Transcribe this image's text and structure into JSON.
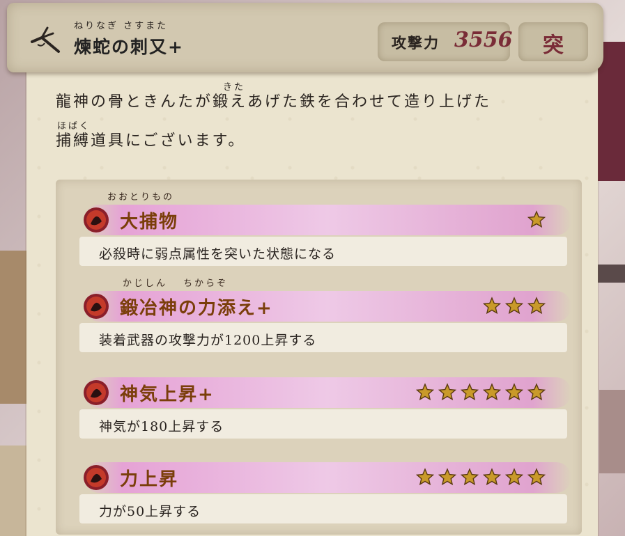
{
  "header": {
    "weapon_ruby": "ねりなぎ さすまた",
    "weapon_name": "煉蛇の刺又+",
    "attack_label": "攻撃力",
    "attack_value": "3556",
    "attack_type": "突"
  },
  "description": {
    "ruby_line1": "きた",
    "line1": "龍神の骨ときんたが鍛えあげた鉄を合わせて造り上げた",
    "ruby_line2": "ほばく",
    "line2": "捕縛道具にございます。"
  },
  "skills": [
    {
      "ruby": "おおとりもの",
      "name": "大捕物",
      "stars": 1,
      "description": "必殺時に弱点属性を突いた状態になる"
    },
    {
      "ruby": "かじしん　 ちからぞ",
      "name": "鍛冶神の力添え+",
      "stars": 3,
      "description": "装着武器の攻撃力が1200上昇する"
    },
    {
      "ruby": "",
      "name": "神気上昇+",
      "stars": 6,
      "description": "神気が180上昇する"
    },
    {
      "ruby": "",
      "name": "力上昇",
      "stars": 6,
      "description": "力が50上昇する"
    }
  ],
  "colors": {
    "skill_name": "#7a3e0a",
    "attack_value": "#7a2c37",
    "star_fill": "#c99a2a"
  }
}
